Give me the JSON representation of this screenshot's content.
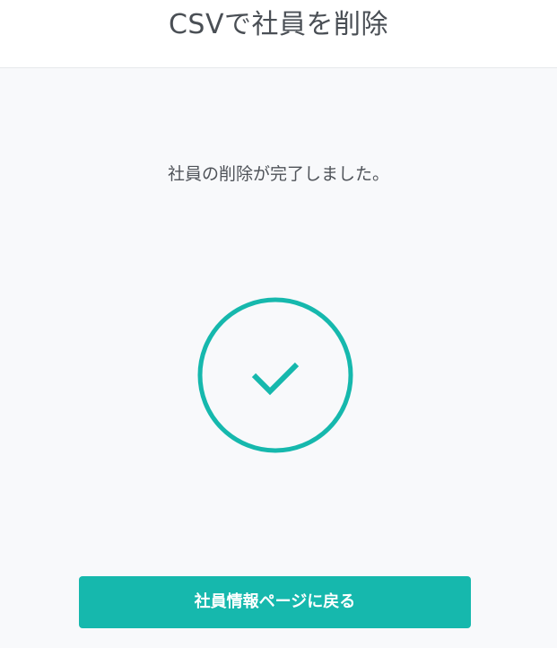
{
  "header": {
    "title": "CSVで社員を削除"
  },
  "main": {
    "message": "社員の削除が完了しました。",
    "success_icon": "check-circle-icon",
    "back_button_label": "社員情報ページに戻る"
  },
  "colors": {
    "accent": "#16b8ad",
    "background": "#f8f9fb",
    "header_background": "#ffffff",
    "text": "#4f5359"
  }
}
